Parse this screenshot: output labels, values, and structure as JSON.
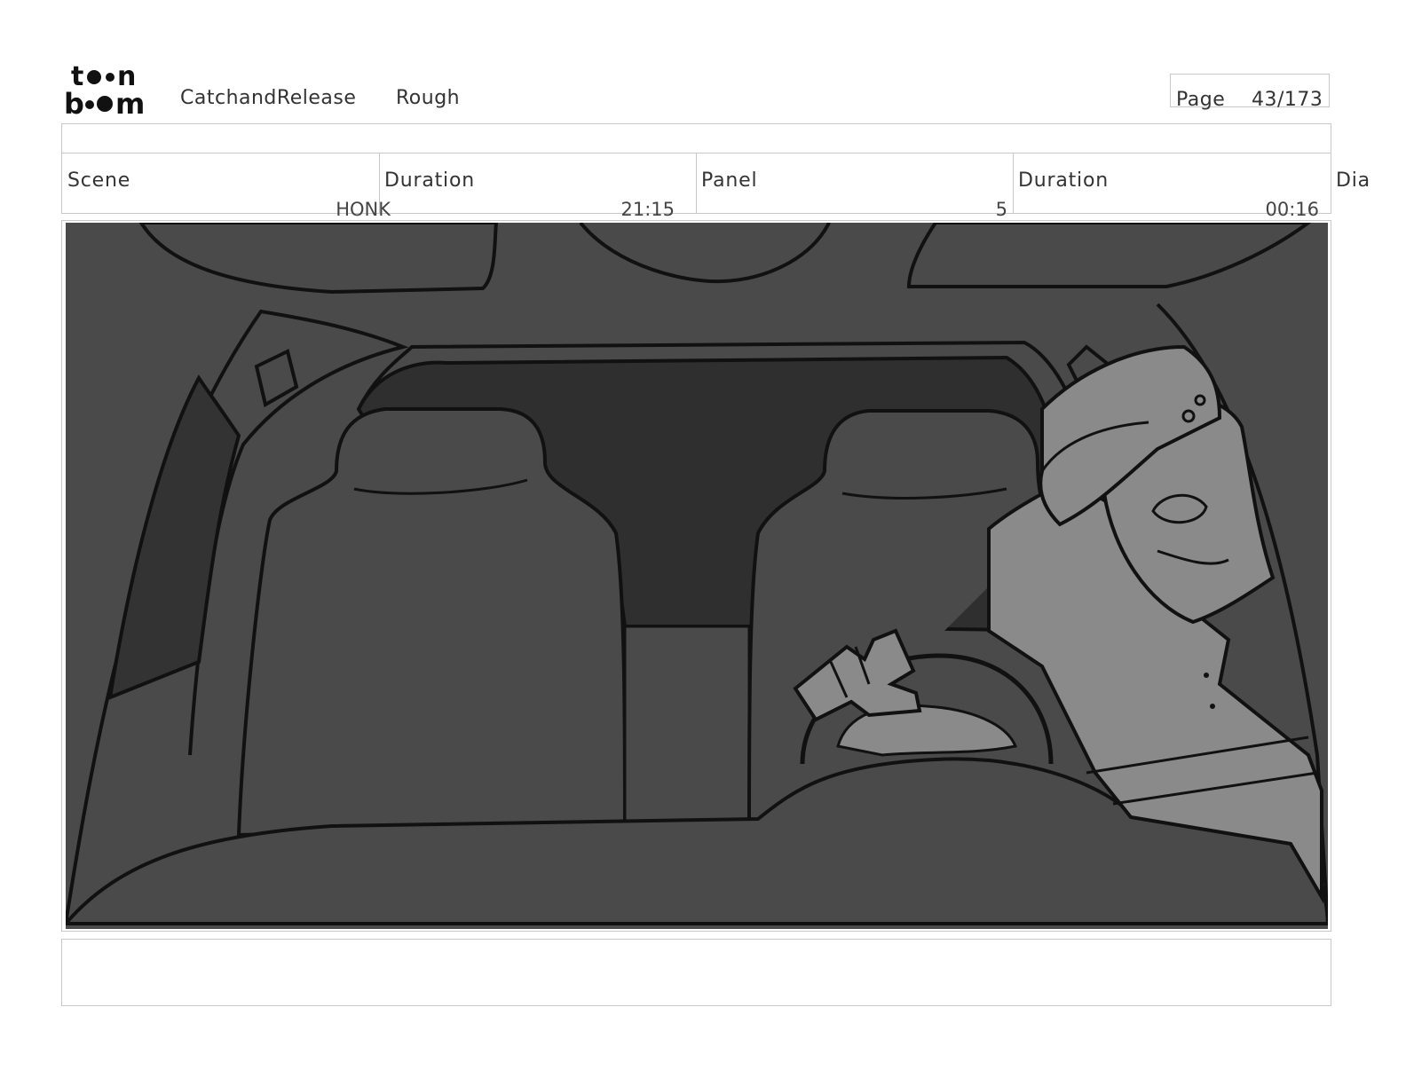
{
  "header": {
    "logo_alt": "toonboom",
    "project": "CatchandRelease",
    "stage": "Rough",
    "page_label": "Page",
    "page_number": "43/173"
  },
  "info": {
    "scene_label": "Scene",
    "scene_value": "HONK",
    "scene_duration_label": "Duration",
    "scene_duration_value": "21:15",
    "panel_label": "Panel",
    "panel_value": "5",
    "panel_duration_label": "Duration",
    "panel_duration_value": "00:16",
    "dialogue_label": "Dia"
  },
  "colors": {
    "frame_border": "#c8c8c8",
    "interior": "#4a4a4a",
    "windshield": "#2f2f2f",
    "character": "#8a8a8a",
    "line": "#111111"
  }
}
